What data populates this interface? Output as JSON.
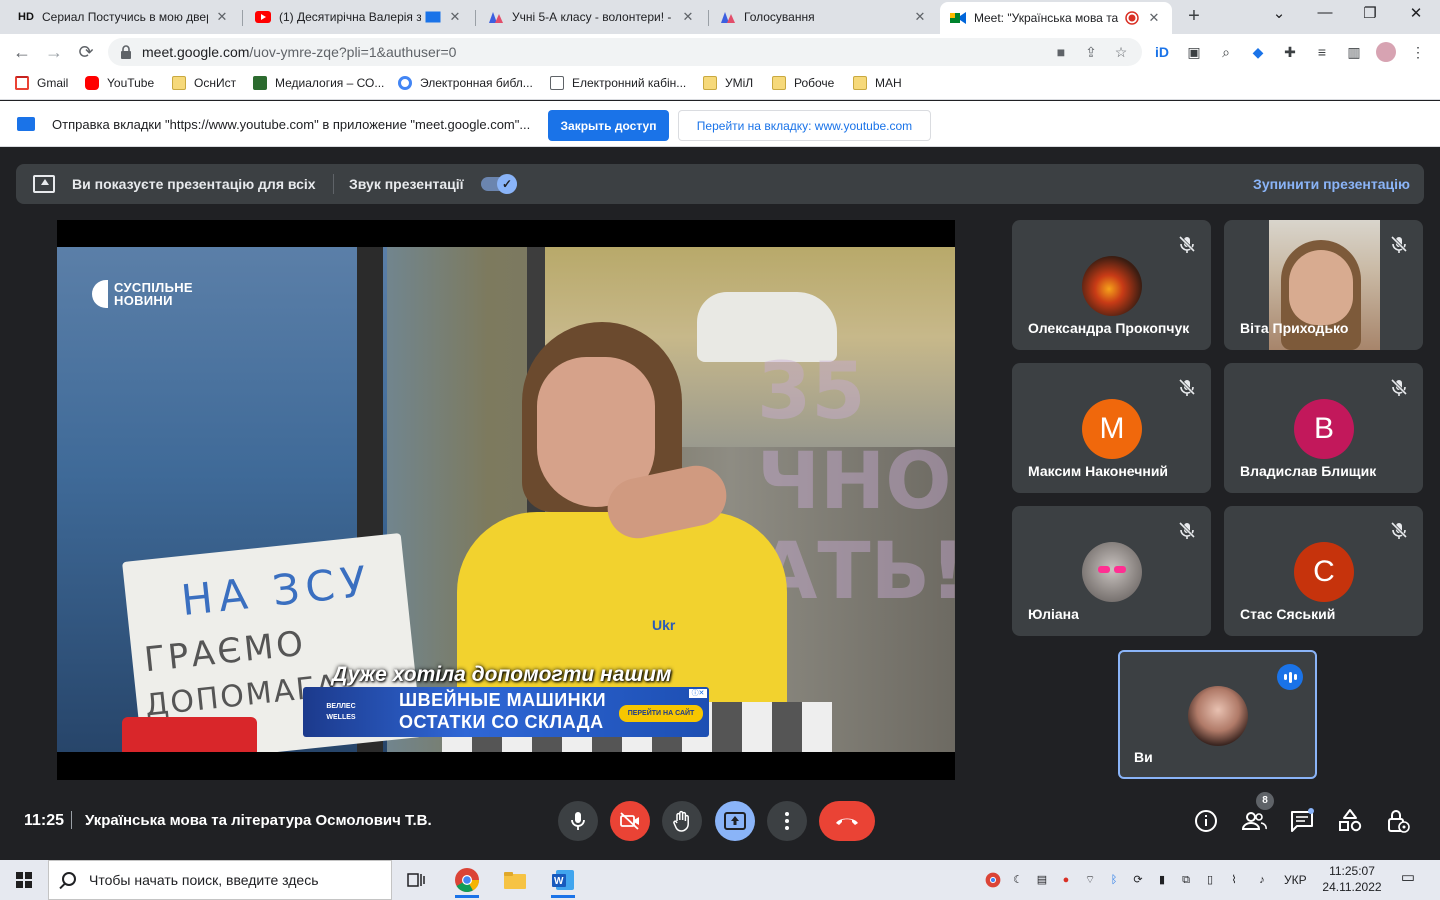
{
  "browser": {
    "tabs": [
      {
        "label": "Сериал Постучись в мою двер",
        "favicon": "HD"
      },
      {
        "label": "(1) Десятирічна Валерія зі",
        "favicon": "youtube-icon"
      },
      {
        "label": "Учні 5-А класу - волонтери! - M",
        "favicon": "mentimeter-icon"
      },
      {
        "label": "Голосування",
        "favicon": "mentimeter-icon"
      },
      {
        "label": "Meet: \"Українська мова та",
        "favicon": "meet-icon",
        "active": true
      }
    ],
    "url_host": "meet.google.com",
    "url_path": "/uov-ymre-zqe?pli=1&authuser=0",
    "bookmarks": [
      {
        "label": "Gmail",
        "icon": "gmail-icon"
      },
      {
        "label": "YouTube",
        "icon": "youtube-icon"
      },
      {
        "label": "ОснИст",
        "icon": "folder-icon"
      },
      {
        "label": "Медиалогия – СО...",
        "icon": "medialogia-icon"
      },
      {
        "label": "Электронная библ...",
        "icon": "library-icon"
      },
      {
        "label": "Електронний кабін...",
        "icon": "doc-icon"
      },
      {
        "label": "УМіЛ",
        "icon": "folder-icon"
      },
      {
        "label": "Робоче",
        "icon": "folder-icon"
      },
      {
        "label": "МАН",
        "icon": "folder-icon"
      }
    ]
  },
  "infobar": {
    "message": "Отправка вкладки \"https://www.youtube.com\" в приложение \"meet.google.com\"...",
    "stop_button": "Закрыть доступ",
    "switch_button": "Перейти на вкладку: www.youtube.com"
  },
  "presenting": {
    "text": "Ви показуєте презентацію для всіх",
    "audio_label": "Звук презентації",
    "audio_on": true,
    "stop_label": "Зупинити презентацію"
  },
  "video": {
    "logo_line1": "СУСПІЛЬНЕ",
    "logo_line2": "НОВИНИ",
    "subtitle": "Дуже хотіла допомогти нашим",
    "sign_line1": "НА ЗСУ",
    "sign_line2": "ГРАЄМО",
    "sign_line3": "ДОПОМАГА",
    "shirt_text": "Ukr",
    "ad": {
      "brand": "ВЕЛЛЕС WELLES",
      "line1": "ШВЕЙНЫЕ МАШИНКИ",
      "line2": "ОСТАТКИ СО СКЛАДА",
      "cta": "ПЕРЕЙТИ НА САЙТ"
    }
  },
  "participants": [
    {
      "name": "Олександра Прокопчук",
      "avatar": "photo",
      "muted": true
    },
    {
      "name": "Віта Приходько",
      "avatar": "video",
      "muted": true
    },
    {
      "name": "Максим Наконечний",
      "initial": "М",
      "color": "#f0680c",
      "muted": true
    },
    {
      "name": "Владислав Блищик",
      "initial": "В",
      "color": "#c2185b",
      "muted": true
    },
    {
      "name": "Юліана",
      "avatar": "photo",
      "muted": true
    },
    {
      "name": "Стас Сяський",
      "initial": "С",
      "color": "#c6330c",
      "muted": true
    }
  ],
  "self": {
    "name": "Ви",
    "speaking": true
  },
  "meeting": {
    "time": "11:25",
    "title": "Українська мова та література Осмолович Т.В.",
    "people_count": "8"
  },
  "taskbar": {
    "search_placeholder": "Чтобы начать поиск, введите здесь",
    "lang": "УКР",
    "time": "11:25:07",
    "date": "24.11.2022"
  }
}
